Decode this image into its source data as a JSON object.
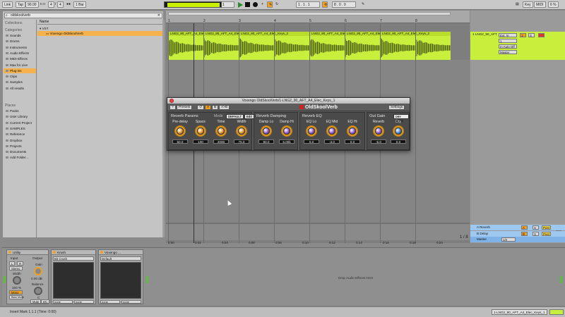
{
  "transport": {
    "link": "Link",
    "tap": "Tap",
    "tempo": "90.00",
    "time_sig_num": "4",
    "time_sig_den": "4",
    "quantize": "1 Bar",
    "position": "1 . 1 . 1",
    "loop_start": "1 . 1 . 1",
    "loop_length": "8 . 0 . 0",
    "key": "Key",
    "midi": "MIDI",
    "cpu": "6 %",
    "colors": {
      "play": "#2a8b2a",
      "cpu_meter": "#c8f000",
      "accent": "#f0a020"
    }
  },
  "browser": {
    "search_value": "oldskoolverb",
    "collections_header": "Collections",
    "categories_header": "Categories",
    "categories": [
      "Sounds",
      "Drums",
      "Instruments",
      "Audio Effects",
      "MIDI Effects",
      "Max for Live",
      "Plug-ins",
      "Clips",
      "Samples",
      "All results"
    ],
    "selected_category": "Plug-ins",
    "places_header": "Places",
    "places": [
      "Packs",
      "User Library",
      "Current Project",
      "SAMPLES",
      "Reference",
      "Dropbox",
      "Projects",
      "Documents",
      "Add Folder..."
    ],
    "column_header": "Name",
    "folder": "VST",
    "result": "Voxengo OldSkoolVerb",
    "selection_color": "#f4b14c"
  },
  "arrangement": {
    "bar_numbers": [
      "1",
      "2",
      "3",
      "4",
      "5",
      "6",
      "7",
      "8"
    ],
    "clips": [
      "LNG2_90_AFT_A4_Elec_Keys_1",
      "LNG2_90_AFT_A4_Elec_Keys_1",
      "LNG2_90_AFT_A4_Elec_Keys_2",
      "LNG2_90_AFT_A4_Elec_Keys_1",
      "LNG2_90_AFT_A4_Elec_Keys_1",
      "LNG2_90_AFT_A4_Elec_Keys_2"
    ],
    "time_marks": [
      "0:00",
      "0:02",
      "0:04",
      "0:06",
      "0:08",
      "0:10",
      "0:12",
      "0:14",
      "0:16",
      "0:18",
      "0:20"
    ],
    "zoom_label": "1 / 8",
    "clip_color": "#c8ef3c"
  },
  "mixer": {
    "track_name": "1 LNG2_90_AFT_A4",
    "input_type": "Ext. In",
    "input_channel": "1",
    "monitor": "In Auto Off",
    "output": "Master",
    "track_number": "1",
    "s": "S",
    "returns": [
      {
        "name": "A Reverb",
        "letter": "A"
      },
      {
        "name": "B Delay",
        "letter": "B"
      },
      {
        "name": "Master",
        "letter": ""
      }
    ],
    "master_fraction": "1/2",
    "post": "Post"
  },
  "plugin": {
    "window_title": "Voxengo OldSkoolVerb/1-LNG2_90_AFT_A4_Elec_Keys_1",
    "presets_label": "Presets",
    "ab": [
      "A",
      "B",
      "A>B"
    ],
    "logo": "OldSkoolVerb",
    "settings_label": "Settings",
    "sections": {
      "reverb_params": "Reverb Params",
      "mode_label": "Mode",
      "mode_value": "DEFAULT",
      "edit_label": "Edit",
      "reverb_damping": "Reverb Damping",
      "reverb_eq": "Reverb EQ",
      "out_gain": "Out Gain",
      "dry_mute": "DRY MUTE"
    },
    "knobs": [
      {
        "label": "Pre-delay",
        "value": "50.0"
      },
      {
        "label": "Space",
        "value": "100"
      },
      {
        "label": "Time",
        "value": "2000"
      },
      {
        "label": "Width",
        "value": "75.0"
      },
      {
        "label": "Damp Lo",
        "value": "90.0"
      },
      {
        "label": "Damp Hi",
        "value": "5.00k"
      },
      {
        "label": "EQ Lo",
        "value": "0.0"
      },
      {
        "label": "EQ Mid",
        "value": "-3.0"
      },
      {
        "label": "EQ Hi",
        "value": "0.0"
      },
      {
        "label": "Reverb",
        "value": "-6.0"
      },
      {
        "label": "Dry",
        "value": "0.0"
      }
    ]
  },
  "devices": {
    "utility": {
      "title": "Utility",
      "input_label": "Input",
      "output_label": "Output",
      "left": "L",
      "right": "R",
      "stereo": "Stereo",
      "width_label": "Width",
      "width_value": "100 %",
      "mono": "Mono",
      "bass_mono": "Bass Mono",
      "gain_label": "Gain",
      "gain_value": "0.00 dB",
      "balance_label": "Balance",
      "balance_value": "C",
      "mute": "Mute",
      "dc": "DC"
    },
    "krush": {
      "title": "Krush",
      "preset": "Bit Crush",
      "foot_a": "none",
      "foot_b": "none"
    },
    "voxengo": {
      "title": "Voxengo ...",
      "preset": "Default",
      "foot_a": "none",
      "foot_b": "none"
    },
    "drop_text": "Drop Audio Effects Here"
  },
  "status": {
    "message": "Insert Mark 1.1.1 (Time: 0:00)",
    "track": "1-LNG2_90_AFT_A4_Elec_Keys_1"
  }
}
